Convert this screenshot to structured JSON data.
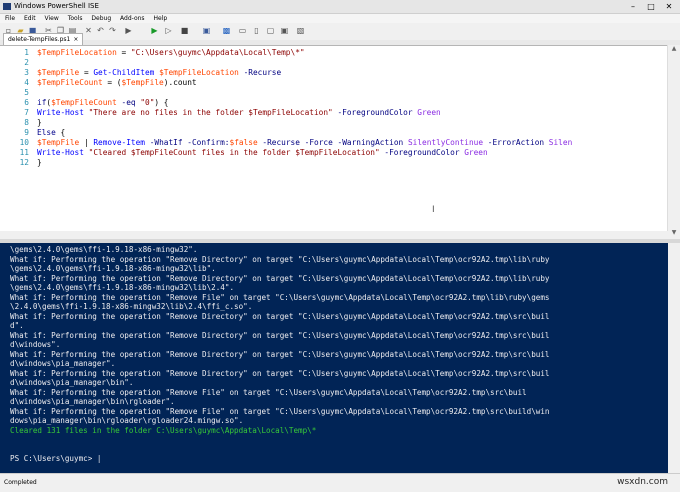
{
  "window": {
    "title": "Windows PowerShell ISE",
    "controls": [
      "–",
      "□",
      "✕"
    ]
  },
  "menu": [
    "File",
    "Edit",
    "View",
    "Tools",
    "Debug",
    "Add-ons",
    "Help"
  ],
  "tab": {
    "label": "delete-TempFiles.ps1",
    "close": "×"
  },
  "editor": {
    "line_numbers": [
      "1",
      "2",
      "3",
      "4",
      "5",
      "6",
      "7",
      "8",
      "9",
      "10",
      "11",
      "12"
    ],
    "lines": [
      "$TempFileLocation = \"C:\\Users\\guymc\\Appdata\\Local\\Temp\\*\"",
      "",
      "$TempFile = Get-ChildItem $TempFileLocation -Recurse",
      "$TempFileCount = ($TempFile).count",
      "",
      "if($TempFileCount -eq \"0\") {",
      "Write-Host \"There are no files in the folder $TempFileLocation\" -ForegroundColor Green",
      "}",
      "Else {",
      "$TempFile | Remove-Item -WhatIf -Confirm:$false -Recurse -Force -WarningAction SilentlyContinue -ErrorAction Silen",
      "Write-Host \"Cleared $TempFileCount files in the folder $TempFileLocation\" -ForegroundColor Green",
      "}"
    ]
  },
  "console": {
    "lines": [
      "\\gems\\2.4.0\\gems\\ffi-1.9.18-x86-mingw32\".",
      "What if: Performing the operation \"Remove Directory\" on target \"C:\\Users\\guymc\\Appdata\\Local\\Temp\\ocr92A2.tmp\\lib\\ruby",
      "\\gems\\2.4.0\\gems\\ffi-1.9.18-x86-mingw32\\lib\".",
      "What if: Performing the operation \"Remove Directory\" on target \"C:\\Users\\guymc\\Appdata\\Local\\Temp\\ocr92A2.tmp\\lib\\ruby",
      "\\gems\\2.4.0\\gems\\ffi-1.9.18-x86-mingw32\\lib\\2.4\".",
      "What if: Performing the operation \"Remove File\" on target \"C:\\Users\\guymc\\Appdata\\Local\\Temp\\ocr92A2.tmp\\lib\\ruby\\gems",
      "\\2.4.0\\gems\\ffi-1.9.18-x86-mingw32\\lib\\2.4\\ffi_c.so\".",
      "What if: Performing the operation \"Remove Directory\" on target \"C:\\Users\\guymc\\Appdata\\Local\\Temp\\ocr92A2.tmp\\src\\buil",
      "d\".",
      "What if: Performing the operation \"Remove Directory\" on target \"C:\\Users\\guymc\\Appdata\\Local\\Temp\\ocr92A2.tmp\\src\\buil",
      "d\\windows\".",
      "What if: Performing the operation \"Remove Directory\" on target \"C:\\Users\\guymc\\Appdata\\Local\\Temp\\ocr92A2.tmp\\src\\buil",
      "d\\windows\\pia_manager\".",
      "What if: Performing the operation \"Remove Directory\" on target \"C:\\Users\\guymc\\Appdata\\Local\\Temp\\ocr92A2.tmp\\src\\buil",
      "d\\windows\\pia_manager\\bin\".",
      "What if: Performing the operation \"Remove File\" on target \"C:\\Users\\guymc\\Appdata\\Local\\Temp\\ocr92A2.tmp\\src\\buil",
      "d\\windows\\pia_manager\\bin\\rgloader\".",
      "What if: Performing the operation \"Remove File\" on target \"C:\\Users\\guymc\\Appdata\\Local\\Temp\\ocr92A2.tmp\\src\\build\\win",
      "dows\\pia_manager\\bin\\rgloader\\rgloader24.mingw.so\"."
    ],
    "result": "Cleared 131 files in the folder C:\\Users\\guymc\\Appdata\\Local\\Temp\\*",
    "prompt": "PS C:\\Users\\guymc> |"
  },
  "status": {
    "text": "Completed"
  },
  "watermark": "wsxdn.com"
}
